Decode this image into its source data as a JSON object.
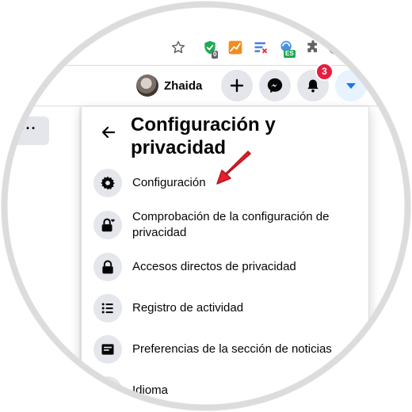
{
  "browser": {
    "extensions": [
      {
        "name": "star-icon"
      },
      {
        "name": "shield-extension-icon",
        "badge": "0"
      },
      {
        "name": "chart-extension-icon"
      },
      {
        "name": "filter-extension-icon"
      },
      {
        "name": "translate-extension-icon",
        "badge": "ES"
      },
      {
        "name": "puzzle-extensions-icon"
      },
      {
        "name": "profile-extension-icon"
      }
    ]
  },
  "header": {
    "profile_name": "Zhaida",
    "create_icon": "plus-icon",
    "messenger_icon": "messenger-icon",
    "notifications_icon": "bell-icon",
    "notifications_count": "3",
    "account_icon": "caret-down-icon"
  },
  "left": {
    "more_label": "···"
  },
  "panel": {
    "title": "Configuración y privacidad",
    "back_icon": "back-arrow-icon",
    "items": [
      {
        "label": "Configuración",
        "icon": "gear-icon"
      },
      {
        "label": "Comprobación de la configuración de privacidad",
        "icon": "lock-heart-icon"
      },
      {
        "label": "Accesos directos de privacidad",
        "icon": "lock-icon"
      },
      {
        "label": "Registro de actividad",
        "icon": "list-icon"
      },
      {
        "label": "Preferencias de la sección de noticias",
        "icon": "feed-icon"
      },
      {
        "label": "Idioma",
        "icon": "globe-icon"
      }
    ]
  },
  "colors": {
    "accent": "#1877f2",
    "notification_red": "#e41e3f",
    "pointer_arrow": "#e4202b"
  }
}
